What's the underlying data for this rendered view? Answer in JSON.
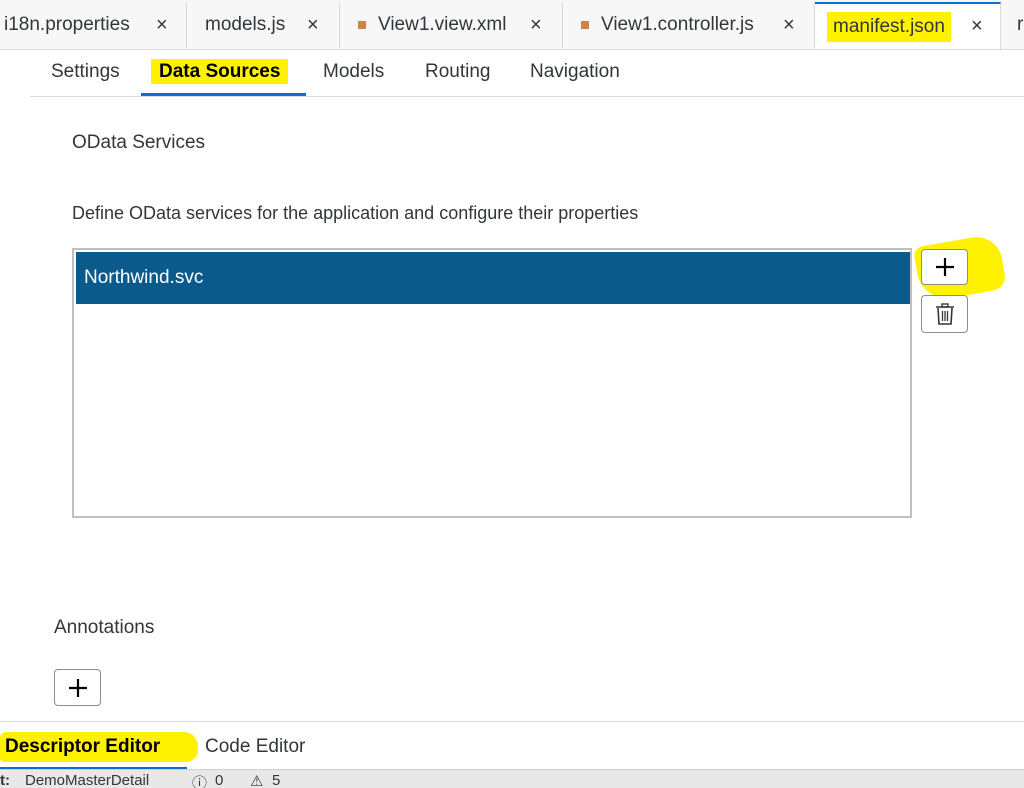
{
  "file_tabs": [
    {
      "label": "i18n.properties"
    },
    {
      "label": "models.js"
    },
    {
      "label": "View1.view.xml"
    },
    {
      "label": "View1.controller.js"
    },
    {
      "label": "manifest.json"
    }
  ],
  "file_tab_overflow": "r",
  "close_glyph": "×",
  "sub_tabs": [
    "Settings",
    "Data Sources",
    "Models",
    "Routing",
    "Navigation"
  ],
  "odata": {
    "title": "OData Services",
    "description": "Define OData services for the application and configure their properties",
    "services": [
      "Northwind.svc"
    ]
  },
  "annotations": {
    "title": "Annotations"
  },
  "editor_tabs": [
    "Descriptor Editor",
    "Code Editor"
  ],
  "status_bar": {
    "project_label": "t:",
    "project": "DemoMasterDetail",
    "errors": "0",
    "warnings": "5"
  },
  "colors": {
    "accent": "#0a6ed1",
    "selection": "#0a5a8c",
    "highlight": "#fff200",
    "modified_dot": "#c8874a"
  }
}
